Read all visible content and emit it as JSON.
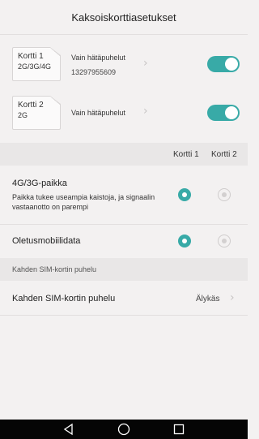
{
  "header": {
    "title": "Kaksoiskorttiasetukset"
  },
  "sims": [
    {
      "card_label": "Kortti 1",
      "card_type": "2G/3G/4G",
      "mode": "Vain hätäpuhelut",
      "number": "13297955609",
      "enabled": true
    },
    {
      "card_label": "Kortti 2",
      "card_type": "2G",
      "mode": "Vain hätäpuhelut",
      "number": "",
      "enabled": true
    }
  ],
  "columns": {
    "card1": "Kortti 1",
    "card2": "Kortti 2"
  },
  "settings": {
    "network": {
      "title": "4G/3G-paikka",
      "subtitle": "Paikka tukee useampia kaistoja, ja signaalin vastaanotto on parempi",
      "selected": "card1"
    },
    "data": {
      "title": "Oletusmobiilidata",
      "selected": "card1"
    }
  },
  "dual_call": {
    "section_label": "Kahden SIM-kortin puhelu",
    "item_label": "Kahden SIM-kortin puhelu",
    "value": "Älykäs"
  },
  "icons": {
    "chevron": "chevron-right-icon",
    "nav_back": "triangle-back-icon",
    "nav_home": "circle-home-icon",
    "nav_recent": "square-recent-icon"
  },
  "colors": {
    "accent": "#38aaa7",
    "background": "#f3f1f1",
    "band": "#e9e7e7",
    "navbar": "#050505"
  }
}
